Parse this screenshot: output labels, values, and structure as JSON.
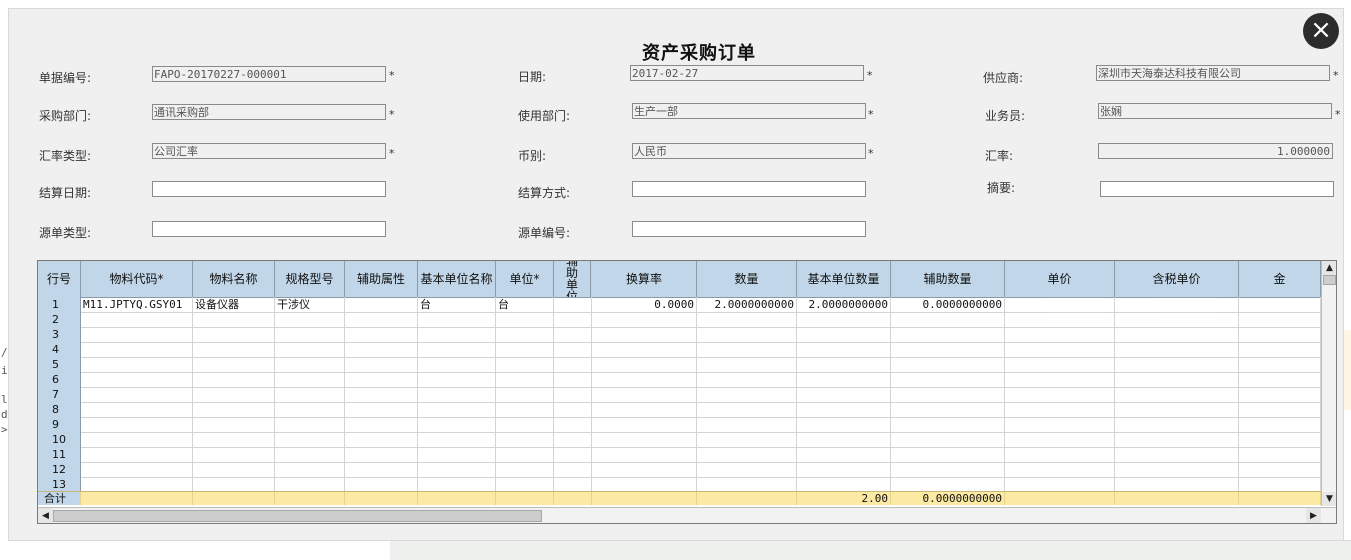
{
  "title": "资产采购订单",
  "close_icon": "×",
  "fields": [
    {
      "label": "单据编号:",
      "value": "FAPO-20170227-000001",
      "required": "*",
      "readonly": true
    },
    {
      "label": "日期:",
      "value": "2017-02-27",
      "required": "*",
      "readonly": true
    },
    {
      "label": "供应商:",
      "value": "深圳市天海泰达科技有限公司",
      "required": "*",
      "readonly": true
    },
    {
      "label": "采购部门:",
      "value": "通讯采购部",
      "required": "*",
      "readonly": true
    },
    {
      "label": "使用部门:",
      "value": "生产一部",
      "required": "*",
      "readonly": true
    },
    {
      "label": "业务员:",
      "value": "张娴",
      "required": "*",
      "readonly": true
    },
    {
      "label": "汇率类型:",
      "value": "公司汇率",
      "required": "*",
      "readonly": true
    },
    {
      "label": "币别:",
      "value": "人民币",
      "required": "*",
      "readonly": true
    },
    {
      "label": "汇率:",
      "value": "1.000000",
      "required": "",
      "readonly": true
    },
    {
      "label": "结算日期:",
      "value": "",
      "required": "",
      "readonly": false
    },
    {
      "label": "结算方式:",
      "value": "",
      "required": "",
      "readonly": false
    },
    {
      "label": "摘要:",
      "value": "",
      "required": "",
      "readonly": false
    },
    {
      "label": "源单类型:",
      "value": "",
      "required": "",
      "readonly": false
    },
    {
      "label": "源单编号:",
      "value": "",
      "required": "",
      "readonly": false
    }
  ],
  "grid": {
    "columns": [
      "行号",
      "物料代码*",
      "物料名称",
      "规格型号",
      "辅助属性",
      "基本单位名称",
      "单位*",
      "辅助单位",
      "换算率",
      "数量",
      "基本单位数量",
      "辅助数量",
      "单价",
      "含税单价",
      "金"
    ],
    "rows": [
      {
        "no": "1",
        "cells": [
          "M11.JPTYQ.GSY01",
          "设备仪器",
          "干涉仪",
          "",
          "台",
          "台",
          "",
          "0.0000",
          "2.0000000000",
          "2.0000000000",
          "0.0000000000",
          "",
          "",
          ""
        ]
      },
      {
        "no": "2",
        "cells": [
          "",
          "",
          "",
          "",
          "",
          "",
          "",
          "",
          "",
          "",
          "",
          "",
          "",
          ""
        ]
      },
      {
        "no": "3",
        "cells": [
          "",
          "",
          "",
          "",
          "",
          "",
          "",
          "",
          "",
          "",
          "",
          "",
          "",
          ""
        ]
      },
      {
        "no": "4",
        "cells": [
          "",
          "",
          "",
          "",
          "",
          "",
          "",
          "",
          "",
          "",
          "",
          "",
          "",
          ""
        ]
      },
      {
        "no": "5",
        "cells": [
          "",
          "",
          "",
          "",
          "",
          "",
          "",
          "",
          "",
          "",
          "",
          "",
          "",
          ""
        ]
      },
      {
        "no": "6",
        "cells": [
          "",
          "",
          "",
          "",
          "",
          "",
          "",
          "",
          "",
          "",
          "",
          "",
          "",
          ""
        ]
      },
      {
        "no": "7",
        "cells": [
          "",
          "",
          "",
          "",
          "",
          "",
          "",
          "",
          "",
          "",
          "",
          "",
          "",
          ""
        ]
      },
      {
        "no": "8",
        "cells": [
          "",
          "",
          "",
          "",
          "",
          "",
          "",
          "",
          "",
          "",
          "",
          "",
          "",
          ""
        ]
      },
      {
        "no": "9",
        "cells": [
          "",
          "",
          "",
          "",
          "",
          "",
          "",
          "",
          "",
          "",
          "",
          "",
          "",
          ""
        ]
      },
      {
        "no": "10",
        "cells": [
          "",
          "",
          "",
          "",
          "",
          "",
          "",
          "",
          "",
          "",
          "",
          "",
          "",
          ""
        ]
      },
      {
        "no": "11",
        "cells": [
          "",
          "",
          "",
          "",
          "",
          "",
          "",
          "",
          "",
          "",
          "",
          "",
          "",
          ""
        ]
      },
      {
        "no": "12",
        "cells": [
          "",
          "",
          "",
          "",
          "",
          "",
          "",
          "",
          "",
          "",
          "",
          "",
          "",
          ""
        ]
      },
      {
        "no": "13",
        "cells": [
          "",
          "",
          "",
          "",
          "",
          "",
          "",
          "",
          "",
          "",
          "",
          "",
          "",
          ""
        ]
      }
    ],
    "total": {
      "label": "合计",
      "cells": [
        "",
        "",
        "",
        "",
        "",
        "",
        "",
        "",
        "",
        "2.00",
        "0.0000000000",
        "",
        "",
        ""
      ]
    }
  },
  "background_fragments": [
    "/",
    "i",
    "l",
    "d",
    ">"
  ],
  "scroll_icons": {
    "up": "▲",
    "down": "▼",
    "left": "◀",
    "right": "▶"
  }
}
